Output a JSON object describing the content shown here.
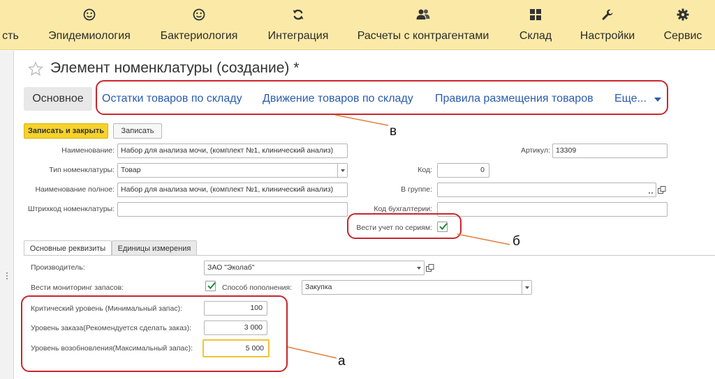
{
  "nav": {
    "partial_label": "сть",
    "items": [
      {
        "label": "Эпидемиология",
        "icon": "smiley-icon"
      },
      {
        "label": "Бактериология",
        "icon": "smiley-icon"
      },
      {
        "label": "Интеграция",
        "icon": "refresh-icon"
      },
      {
        "label": "Расчеты с контрагентами",
        "icon": "users-icon"
      },
      {
        "label": "Склад",
        "icon": "grid-icon"
      },
      {
        "label": "Настройки",
        "icon": "wrench-icon"
      },
      {
        "label": "Сервис",
        "icon": "gear-icon"
      }
    ]
  },
  "form": {
    "title": "Элемент номенклатуры (создание) *",
    "tabs": {
      "main": "Основное",
      "links": [
        "Остатки товаров по складу",
        "Движение товаров по складу",
        "Правила размещения товаров",
        "Еще..."
      ]
    },
    "buttons": {
      "save_close": "Записать и закрыть",
      "save": "Записать"
    },
    "fields": {
      "name_label": "Наименование:",
      "name_value": "Набор для анализа мочи, (комплект №1, клинический анализ)",
      "article_label": "Артикул:",
      "article_value": "13309",
      "type_label": "Тип номенклатуры:",
      "type_value": "Товар",
      "code_label": "Код:",
      "code_value": "0",
      "fullname_label": "Наименование полное:",
      "fullname_value": "Набор для анализа мочи, (комплект №1, клинический анализ)",
      "group_label": "В группе:",
      "group_value": "",
      "barcode_label": "Штрихкод номенклатуры:",
      "barcode_value": "",
      "acc_code_label": "Код бухгалтерии:",
      "acc_code_value": "",
      "series_label": "Вести учет по сериям:"
    },
    "subtabs": [
      "Основные реквизиты",
      "Единицы измерения"
    ],
    "details": {
      "manufacturer_label": "Производитель:",
      "manufacturer_value": "ЗАО \"Эколаб\"",
      "monitoring_label": "Вести мониторинг запасов:",
      "replenish_label": "Способ пополнения:",
      "replenish_value": "Закупка",
      "critical_label": "Критический уровень (Минимальный запас):",
      "critical_value": "100",
      "order_label": "Уровень заказа(Рекомендуется сделать заказ):",
      "order_value": "3 000",
      "restore_label": "Уровень возобновления(Максимальный запас):",
      "restore_value": "5 000"
    }
  },
  "annotations": {
    "a": "а",
    "b": "б",
    "v": "в"
  },
  "colors": {
    "topbar": "#fbeaa7",
    "primary_button": "#f6d22c",
    "link": "#2a5cad",
    "callout": "#c9262c",
    "check": "#1d8a3a"
  }
}
